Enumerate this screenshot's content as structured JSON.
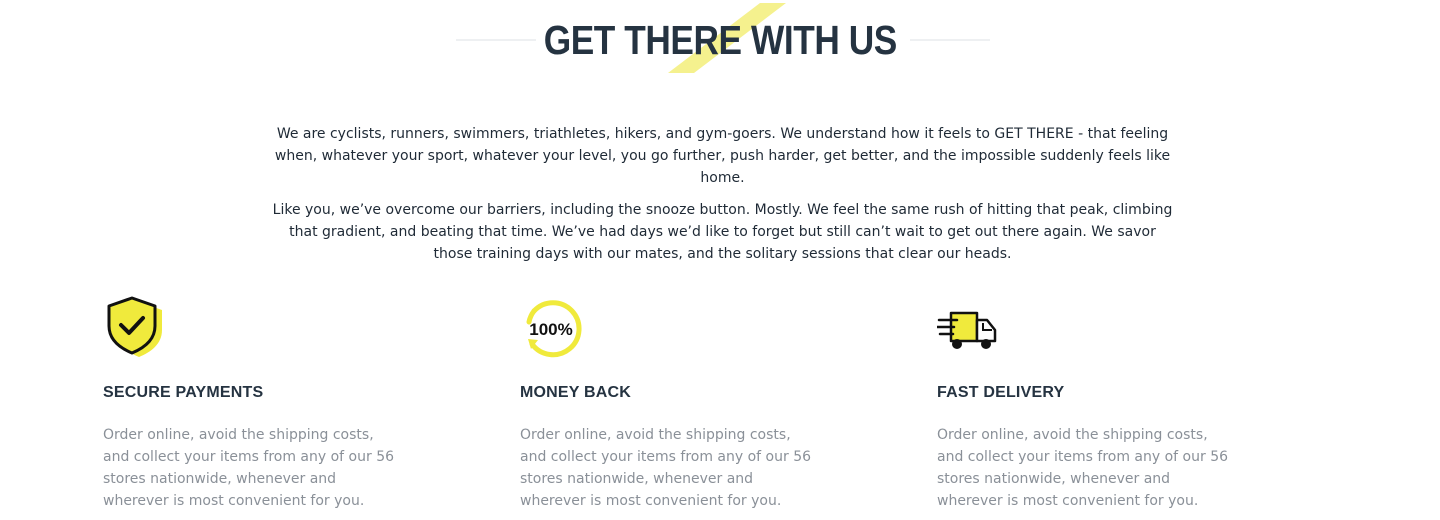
{
  "section": {
    "title": "GET THERE WITH US",
    "accent_color": "#f0ea3c",
    "title_color": "#253341"
  },
  "intro": {
    "paragraphs": [
      "We are cyclists, runners, swimmers, triathletes, hikers, and gym-goers. We understand how it feels to GET THERE - that feeling when, whatever your sport, whatever your level, you go further, push harder, get better, and the impossible suddenly feels like home.",
      "Like you, we’ve overcome our barriers, including the snooze button. Mostly. We feel the same rush of hitting that peak, climbing that gradient, and beating that time. We’ve had days we’d like to forget but still can’t wait to get out there again. We savor those training days with our mates, and the solitary sessions that clear our heads."
    ]
  },
  "features": [
    {
      "icon": "shield-check-icon",
      "title": "SECURE PAYMENTS",
      "text": "Order online, avoid the shipping costs, and collect your items from any of our 56 stores nationwide, whenever and wherever is most convenient for you."
    },
    {
      "icon": "money-back-100-percent-icon",
      "icon_label": "100%",
      "title": "MONEY BACK",
      "text": "Order online, avoid the shipping costs, and collect your items from any of our 56 stores nationwide, whenever and wherever is most convenient for you."
    },
    {
      "icon": "delivery-truck-icon",
      "title": "FAST DELIVERY",
      "text": "Order online, avoid the shipping costs, and collect your items from any of our 56 stores nationwide, whenever and wherever is most convenient for you."
    }
  ]
}
